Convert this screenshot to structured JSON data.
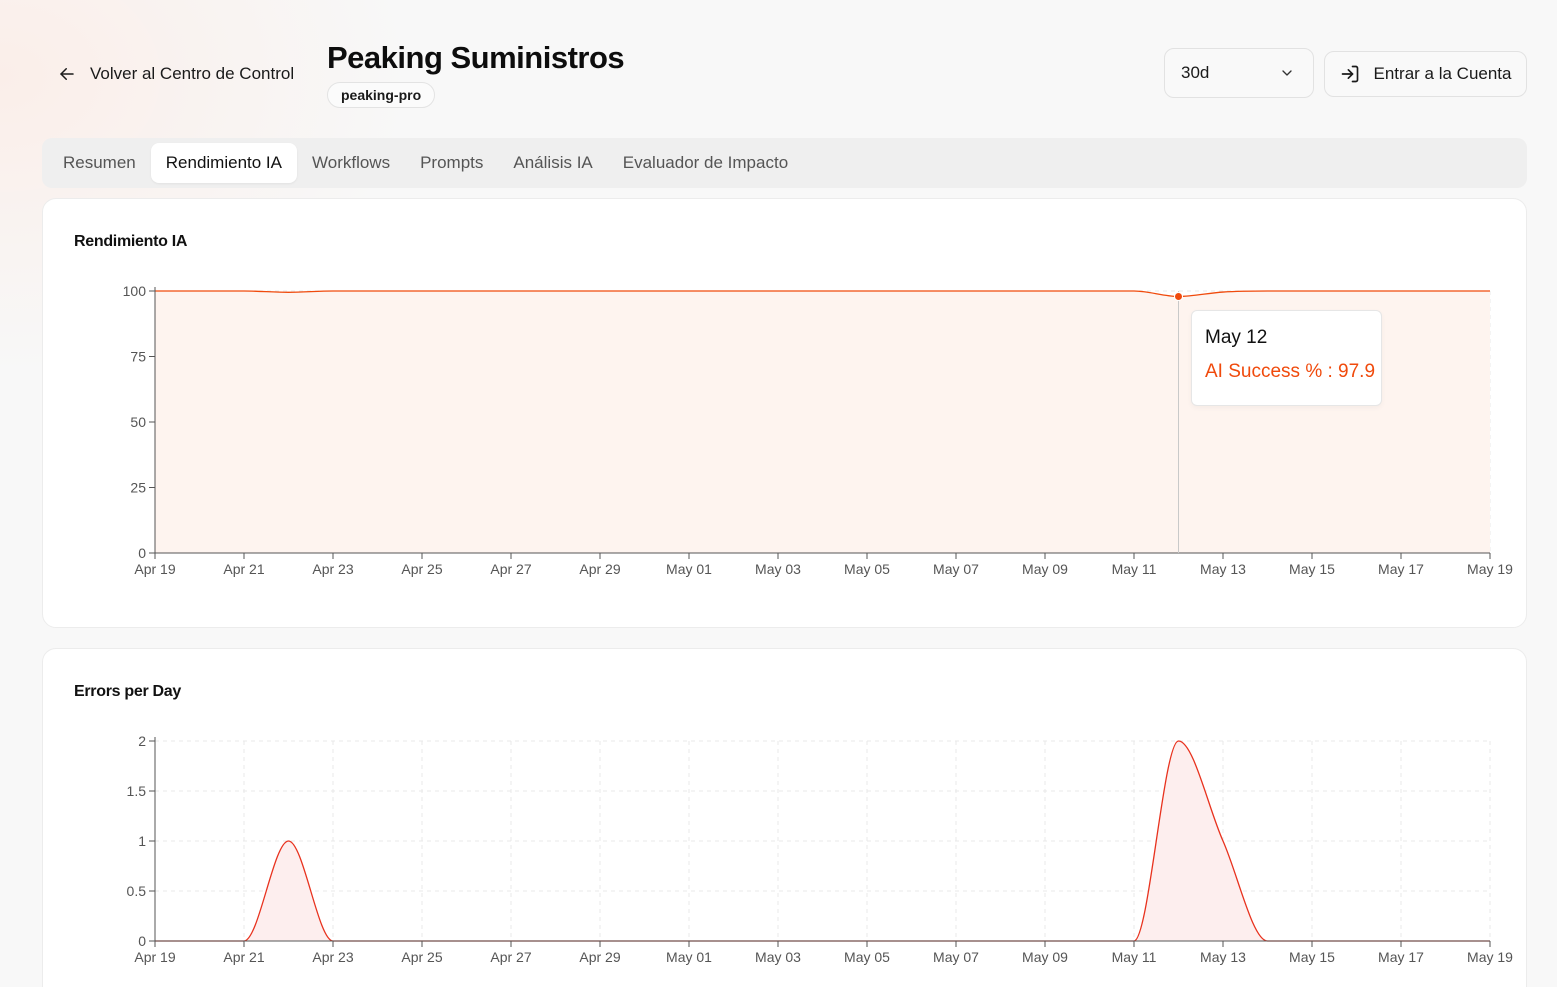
{
  "header": {
    "back_label": "Volver al Centro de Control",
    "title": "Peaking Suministros",
    "slug": "peaking-pro",
    "range_value": "30d",
    "enter_label": "Entrar a la Cuenta"
  },
  "tabs": [
    {
      "label": "Resumen",
      "active": false
    },
    {
      "label": "Rendimiento IA",
      "active": true
    },
    {
      "label": "Workflows",
      "active": false
    },
    {
      "label": "Prompts",
      "active": false
    },
    {
      "label": "Análisis IA",
      "active": false
    },
    {
      "label": "Evaluador de Impacto",
      "active": false
    }
  ],
  "colors": {
    "accent": "#f04a0c",
    "area_fill": "#fef4ef",
    "error_line": "#e8321e",
    "error_fill": "#fdeeee"
  },
  "chart_data": [
    {
      "type": "area",
      "title": "Rendimiento IA",
      "series": [
        {
          "name": "AI Success %",
          "color": "#f04a0c"
        }
      ],
      "x": [
        "Apr 19",
        "Apr 20",
        "Apr 21",
        "Apr 22",
        "Apr 23",
        "Apr 24",
        "Apr 25",
        "Apr 26",
        "Apr 27",
        "Apr 28",
        "Apr 29",
        "Apr 30",
        "May 01",
        "May 02",
        "May 03",
        "May 04",
        "May 05",
        "May 06",
        "May 07",
        "May 08",
        "May 09",
        "May 10",
        "May 11",
        "May 12",
        "May 13",
        "May 14",
        "May 15",
        "May 16",
        "May 17",
        "May 18",
        "May 19"
      ],
      "x_ticks": [
        "Apr 19",
        "Apr 21",
        "Apr 23",
        "Apr 25",
        "Apr 27",
        "Apr 29",
        "May 01",
        "May 03",
        "May 05",
        "May 07",
        "May 09",
        "May 11",
        "May 13",
        "May 15",
        "May 17",
        "May 19"
      ],
      "y": [
        100,
        100,
        100,
        99.5,
        100,
        100,
        100,
        100,
        100,
        100,
        100,
        100,
        100,
        100,
        100,
        100,
        100,
        100,
        100,
        100,
        100,
        100,
        100,
        97.9,
        99.6,
        100,
        100,
        100,
        100,
        100,
        100
      ],
      "y_ticks": [
        "0",
        "25",
        "50",
        "75",
        "100"
      ],
      "ylim": [
        0,
        100
      ],
      "grid": true,
      "tooltip": {
        "date": "May 12",
        "label": "AI Success %",
        "value": "97.9",
        "text": "AI Success % : 97.9"
      }
    },
    {
      "type": "area",
      "title": "Errors per Day",
      "series": [
        {
          "color": "#e8321e"
        }
      ],
      "x": [
        "Apr 19",
        "Apr 20",
        "Apr 21",
        "Apr 22",
        "Apr 23",
        "Apr 24",
        "Apr 25",
        "Apr 26",
        "Apr 27",
        "Apr 28",
        "Apr 29",
        "Apr 30",
        "May 01",
        "May 02",
        "May 03",
        "May 04",
        "May 05",
        "May 06",
        "May 07",
        "May 08",
        "May 09",
        "May 10",
        "May 11",
        "May 12",
        "May 13",
        "May 14",
        "May 15",
        "May 16",
        "May 17",
        "May 18",
        "May 19"
      ],
      "x_ticks": [
        "Apr 19",
        "Apr 21",
        "Apr 23",
        "Apr 25",
        "Apr 27",
        "Apr 29",
        "May 01",
        "May 03",
        "May 05",
        "May 07",
        "May 09",
        "May 11",
        "May 13",
        "May 15",
        "May 17",
        "May 19"
      ],
      "y": [
        0,
        0,
        0,
        1,
        0,
        0,
        0,
        0,
        0,
        0,
        0,
        0,
        0,
        0,
        0,
        0,
        0,
        0,
        0,
        0,
        0,
        0,
        0,
        2,
        1,
        0,
        0,
        0,
        0,
        0,
        0
      ],
      "y_ticks": [
        "0",
        "0.5",
        "1",
        "1.5",
        "2"
      ],
      "ylim": [
        0,
        2
      ],
      "grid": true
    }
  ]
}
